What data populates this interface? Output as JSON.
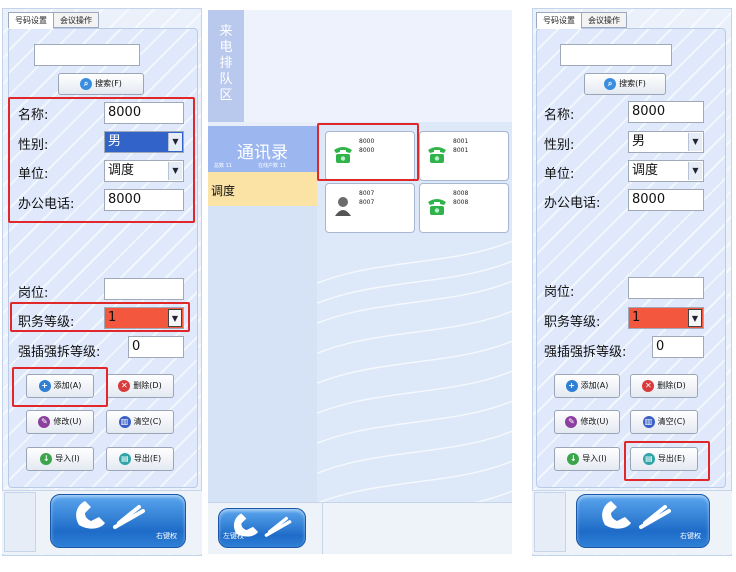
{
  "tabs": [
    "号码设置",
    "会议操作"
  ],
  "search_button": "搜索(F)",
  "fields": {
    "name_label": "名称:",
    "name_value": "8000",
    "gender_label": "性别:",
    "gender_value": "男",
    "unit_label": "单位:",
    "unit_value": "调度",
    "phone_label": "办公电话:",
    "phone_value": "8000",
    "post_label": "岗位:",
    "post_value": "",
    "rank_label": "职务等级:",
    "rank_value": "1",
    "override_label": "强插强拆等级:",
    "override_value": "0"
  },
  "buttons": {
    "add": "添加(A)",
    "delete": "删除(D)",
    "modify": "修改(U)",
    "clear": "清空(C)",
    "import": "导入(I)",
    "export": "导出(E)"
  },
  "right_handset_label": "右键权",
  "left_handset_label": "左键权",
  "queue_title": "来电排队区",
  "contacts": {
    "title": "通讯录",
    "meta_left": "总数 11",
    "meta_right": "在线户数 11",
    "group": "调度"
  },
  "cards": [
    {
      "line1": "8000",
      "line2": "8000",
      "icon": "green-phone-icon"
    },
    {
      "line1": "8001",
      "line2": "8001",
      "icon": "green-phone-icon"
    },
    {
      "line1": "8007",
      "line2": "8007",
      "icon": "person-icon"
    },
    {
      "line1": "8008",
      "line2": "8008",
      "icon": "green-phone-icon"
    }
  ],
  "colors": {
    "highlight": "#e0282b",
    "selected_blue": "#3163c9",
    "rank_red": "#f3583e",
    "contact_item": "#fbe3a6"
  }
}
